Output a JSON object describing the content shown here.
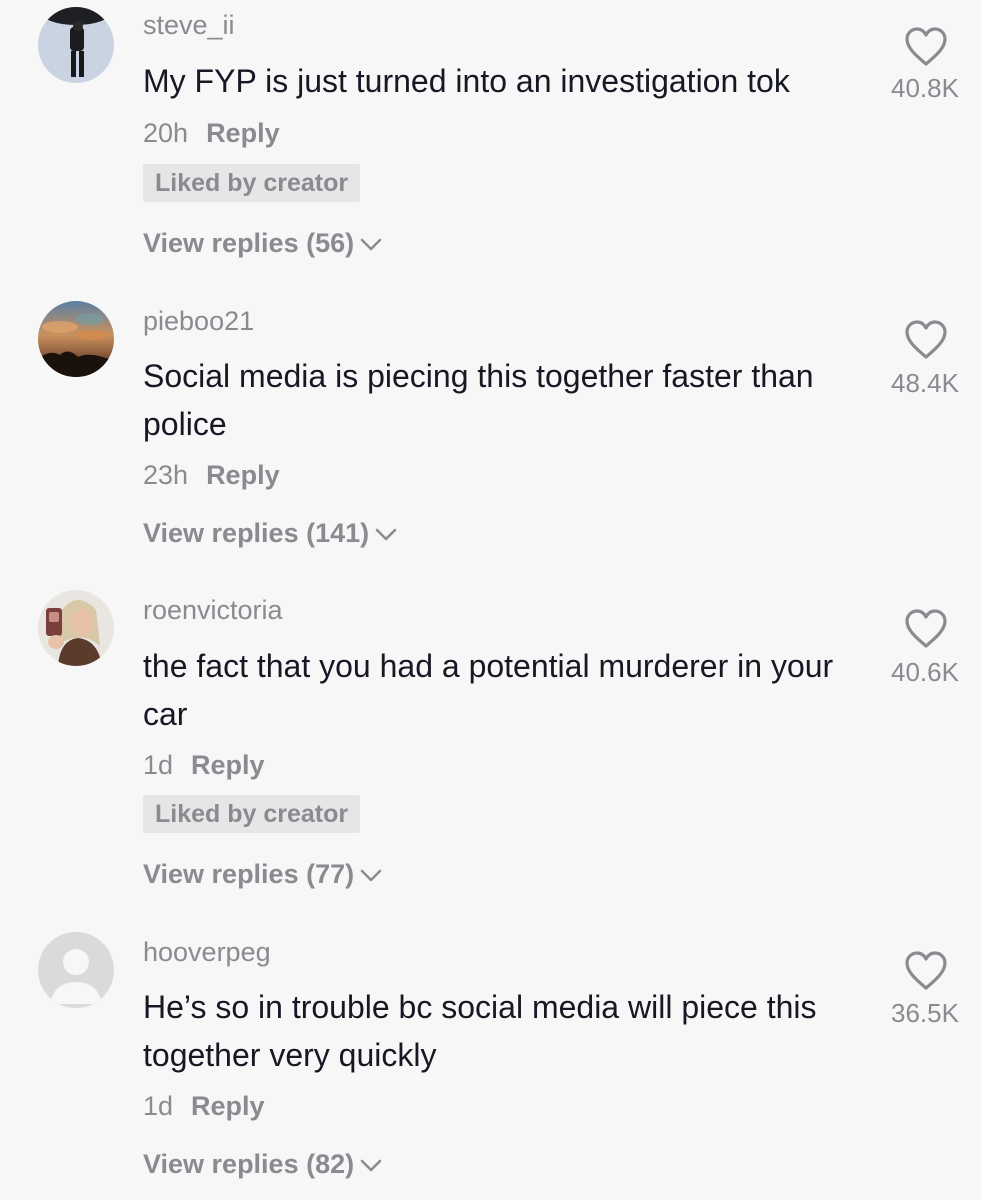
{
  "comments": [
    {
      "username": "steve_ii",
      "text": "My FYP is just turned into an investigation tok",
      "time": "20h",
      "reply_label": "Reply",
      "liked_by_creator": "Liked by creator",
      "view_replies": "View replies (56)",
      "likes": "40.8K",
      "avatar_icon": "avatar-person-umbrella"
    },
    {
      "username": "pieboo21",
      "text": "Social media is piecing this together faster than police",
      "time": "23h",
      "reply_label": "Reply",
      "view_replies": "View replies (141)",
      "likes": "48.4K",
      "avatar_icon": "avatar-sunset-sky"
    },
    {
      "username": "roenvictoria",
      "text": "the fact that you had a potential murderer in your car",
      "time": "1d",
      "reply_label": "Reply",
      "liked_by_creator": "Liked by creator",
      "view_replies": "View replies (77)",
      "likes": "40.6K",
      "avatar_icon": "avatar-selfie"
    },
    {
      "username": "hooverpeg",
      "text": "He’s so in trouble bc social media will piece this together very quickly",
      "time": "1d",
      "reply_label": "Reply",
      "view_replies": "View replies (82)",
      "likes": "36.5K",
      "avatar_icon": "avatar-default"
    }
  ],
  "colors": {
    "background": "#f7f7f7",
    "text_primary": "#161823",
    "text_secondary": "#8a8b91",
    "badge_bg": "#e6e6e7"
  }
}
